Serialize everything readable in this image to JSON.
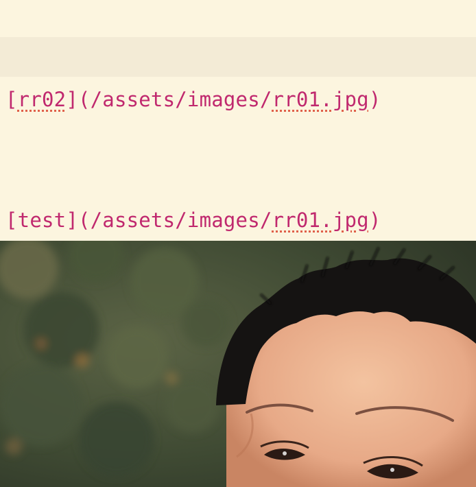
{
  "editor": {
    "lines": [
      {
        "open_bracket": "[",
        "alt_text": "rr02",
        "mid_path": "](/assets/images/",
        "file_name": "rr01.jpg",
        "close_paren": ")"
      },
      {
        "open_bracket": "[",
        "alt_text": "test",
        "mid_path": "](/assets/images/",
        "file_name": "rr01.jpg",
        "close_paren": ")"
      }
    ],
    "colors": {
      "background": "#fcf5df",
      "active_line": "#f3ebd6",
      "link_text": "#c0286e",
      "spellcheck": "#e0604a"
    }
  },
  "image_preview": {
    "subject": "child-portrait-photo"
  }
}
